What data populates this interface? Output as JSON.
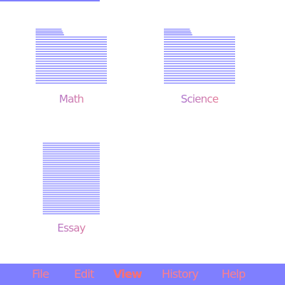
{
  "colors": {
    "accent": "#7f7fff",
    "label_gradient_start": "#8f6fe8",
    "label_gradient_end": "#ff7f7f",
    "menubar_bg": "#7f7fff",
    "menu_text": "#ff7f8a",
    "menu_active_text": "#ff6f6f",
    "background": "#ffffff"
  },
  "desktop": {
    "items": [
      {
        "label": "Math",
        "icon": "folder-icon"
      },
      {
        "label": "Science",
        "icon": "folder-icon"
      },
      {
        "label": "Essay",
        "icon": "document-icon"
      }
    ]
  },
  "menubar": {
    "items": [
      {
        "label": "File",
        "active": false
      },
      {
        "label": "Edit",
        "active": false
      },
      {
        "label": "View",
        "active": true
      },
      {
        "label": "History",
        "active": false
      },
      {
        "label": "Help",
        "active": false
      }
    ]
  }
}
